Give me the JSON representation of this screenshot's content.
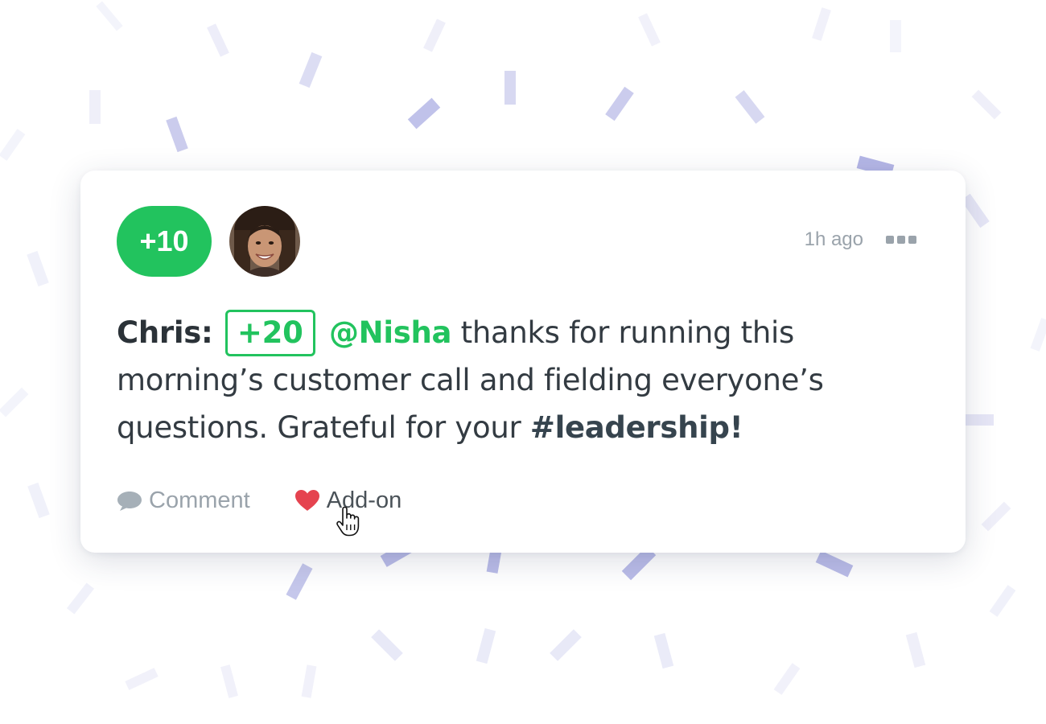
{
  "post": {
    "points_badge": "+10",
    "time": "1h ago",
    "author": "Chris:",
    "award": "+20",
    "mention": "@Nisha",
    "text_1": " thanks for running this morning’s customer call and fielding everyone’s questions. Grateful for your ",
    "hashtag": "#leadership",
    "text_2": "!"
  },
  "actions": {
    "comment_label": "Comment",
    "addon_label": "Add-on"
  },
  "icons": {
    "more": "more-horizontal-icon",
    "comment": "speech-bubble-icon",
    "addon": "heart-icon",
    "cursor": "hand-pointer-icon"
  },
  "colors": {
    "accent_green": "#22c35e",
    "heart_red": "#e5434f",
    "muted_gray": "#9aa3ab",
    "confetti": "#8c8fd8"
  }
}
